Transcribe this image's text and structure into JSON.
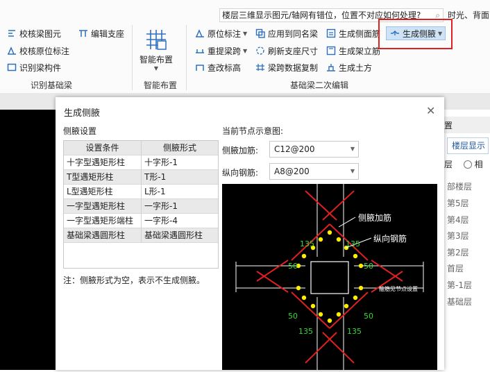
{
  "help": {
    "search_text": "楼层三维显示图元/轴网有错位，位置不对应如何处理?",
    "extra": "时光、背面"
  },
  "ribbon": {
    "group1": {
      "label": "识别基础梁",
      "items": [
        "校核梁图元",
        "编辑支座",
        "校核原位标注",
        "识别梁构件"
      ]
    },
    "group2": {
      "label": "智能布置",
      "button": "智能布置"
    },
    "group3": {
      "label": "基础梁二次编辑",
      "col1": [
        "原位标注",
        "重提梁跨",
        "查改标高"
      ],
      "col2": [
        "应用到同名梁",
        "刷新支座尺寸",
        "梁跨数据复制"
      ],
      "col3": [
        "生成侧面筋",
        "生成架立筋",
        "生成土方"
      ],
      "highlighted": "生成侧腋"
    }
  },
  "right_panel": {
    "header": "置",
    "tab": "楼层显示",
    "radio_left": "层",
    "radio_right": "相",
    "floors": [
      "部楼层",
      "第5层",
      "第4层",
      "第3层",
      "第2层",
      "首层",
      "第-1层",
      "基础层"
    ]
  },
  "dialog": {
    "title": "生成侧腋",
    "settings_label": "侧腋设置",
    "table": {
      "headers": [
        "设置条件",
        "侧腋形式"
      ],
      "rows": [
        [
          "十字型遇矩形柱",
          "十字形-1"
        ],
        [
          "T型遇矩形柱",
          "T形-1"
        ],
        [
          "L型遇矩形柱",
          "L形-1"
        ],
        [
          "一字型遇矩形柱",
          "一字形-1"
        ],
        [
          "一字型遇矩形端柱",
          "一字形-4"
        ],
        [
          "基础梁遇圆形柱",
          "基础梁遇圆形柱"
        ]
      ]
    },
    "note": "注：侧腋形式为空，表示不生成侧腋。",
    "diagram_label": "当前节点示意图:",
    "haunch_rebar_label": "侧腋加筋:",
    "haunch_rebar_value": "C12@200",
    "long_rebar_label": "纵向钢筋:",
    "long_rebar_value": "A8@200",
    "diagram_text": {
      "haunch": "侧腋加筋",
      "long": "纵向钢筋",
      "angle": "135",
      "dim": "50",
      "ref": "箍筋见节点设置"
    }
  }
}
